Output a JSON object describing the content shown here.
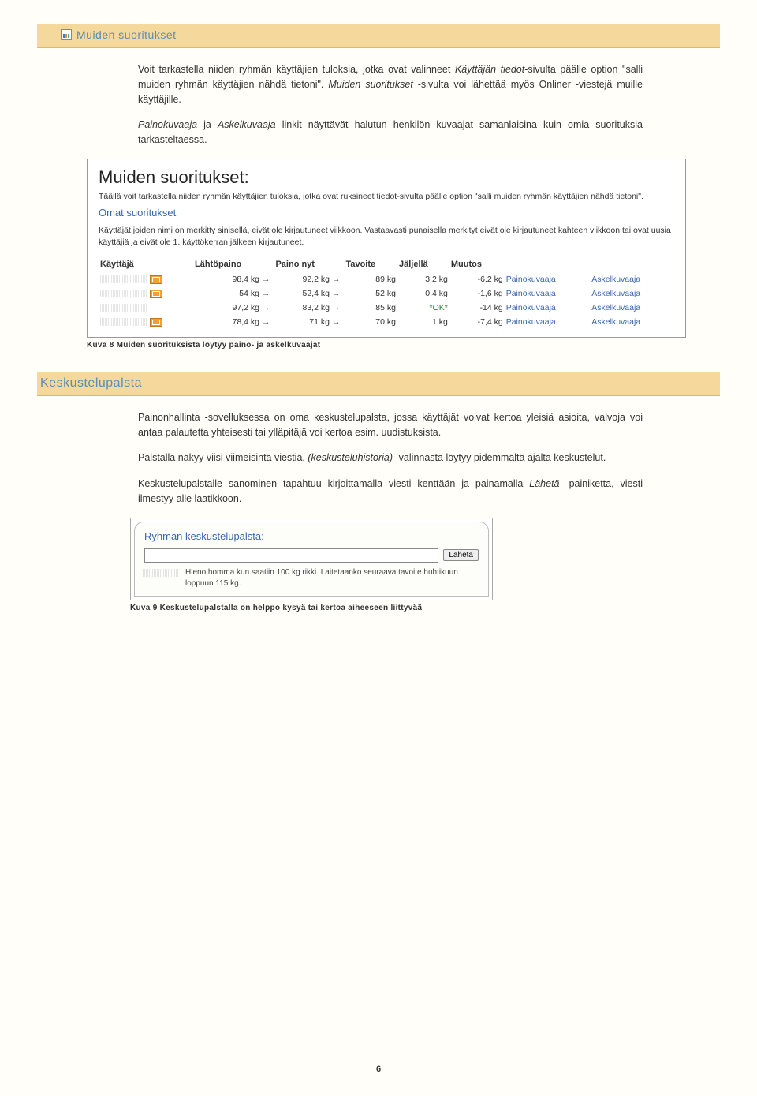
{
  "section1": {
    "title": "Muiden suoritukset",
    "para1a": "Voit tarkastella niiden ryhmän käyttäjien tuloksia, jotka ovat valinneet ",
    "para1b": "Käyttäjän tiedot",
    "para1c": "-sivulta päälle option \"salli muiden ryhmän käyttäjien nähdä tietoni\". ",
    "para1d": "Muiden suoritukset",
    "para1e": " -sivulta voi lähettää myös Onliner -viestejä muille käyttäjille.",
    "para2a": "Painokuvaaja",
    "para2b": " ja ",
    "para2c": "Askelkuvaaja",
    "para2d": " linkit näyttävät halutun henkilön kuvaajat samanlaisina kuin omia suorituksia tarkasteltaessa."
  },
  "shot1": {
    "title": "Muiden suoritukset:",
    "desc": "Täällä voit tarkastella niiden ryhmän käyttäjien tuloksia, jotka ovat ruksineet tiedot-sivulta päälle option \"salli muiden ryhmän käyttäjien nähdä tietoni\".",
    "link": "Omat suoritukset",
    "note": "Käyttäjät joiden nimi on merkitty sinisellä, eivät ole kirjautuneet viikkoon. Vastaavasti punaisella merkityt eivät ole kirjautuneet kahteen viikkoon tai ovat uusia käyttäjiä ja eivät ole 1. käyttökerran jälkeen kirjautuneet.",
    "headers": {
      "user": "Käyttäjä",
      "start": "Lähtöpaino",
      "now": "Paino nyt",
      "target": "Tavoite",
      "left": "Jäljellä",
      "change": "Muutos"
    },
    "link1": "Painokuvaaja",
    "link2": "Askelkuvaaja",
    "rows": [
      {
        "start": "98,4 kg",
        "now": "92,2 kg",
        "target": "89 kg",
        "left": "3,2 kg",
        "change": "-6,2 kg",
        "ok": false
      },
      {
        "start": "54 kg",
        "now": "52,4 kg",
        "target": "52 kg",
        "left": "0,4 kg",
        "change": "-1,6 kg",
        "ok": false
      },
      {
        "start": "97,2 kg",
        "now": "83,2 kg",
        "target": "85 kg",
        "left": "*OK*",
        "change": "-14 kg",
        "ok": true
      },
      {
        "start": "78,4 kg",
        "now": "71 kg",
        "target": "70 kg",
        "left": "1 kg",
        "change": "-7,4 kg",
        "ok": false
      }
    ]
  },
  "caption1": "Kuva 8  Muiden suorituksista löytyy paino- ja askelkuvaajat",
  "section2": {
    "title": "Keskustelupalsta",
    "para1": "Painonhallinta -sovelluksessa on oma keskustelupalsta, jossa käyttäjät voivat kertoa yleisiä asioita, valvoja voi antaa palautetta yhteisesti tai ylläpitäjä voi kertoa esim. uudistuksista.",
    "para2a": "Palstalla näkyy viisi viimeisintä viestiä, ",
    "para2b": "(keskusteluhistoria)",
    "para2c": " -valinnasta löytyy pidemmältä ajalta keskustelut.",
    "para3a": "Keskustelupalstalle sanominen tapahtuu kirjoittamalla viesti kenttään ja painamalla ",
    "para3b": "Lähetä",
    "para3c": " -painiketta, viesti ilmestyy alle laatikkoon."
  },
  "shot2": {
    "title": "Ryhmän keskustelupalsta:",
    "button": "Lähetä",
    "msg": "Hieno homma kun saatiin 100 kg rikki. Laitetaanko seuraava tavoite huhtikuun loppuun 115 kg."
  },
  "caption2": "Kuva 9 Keskustelupalstalla on helppo kysyä tai kertoa aiheeseen liittyvää",
  "pageNum": "6"
}
